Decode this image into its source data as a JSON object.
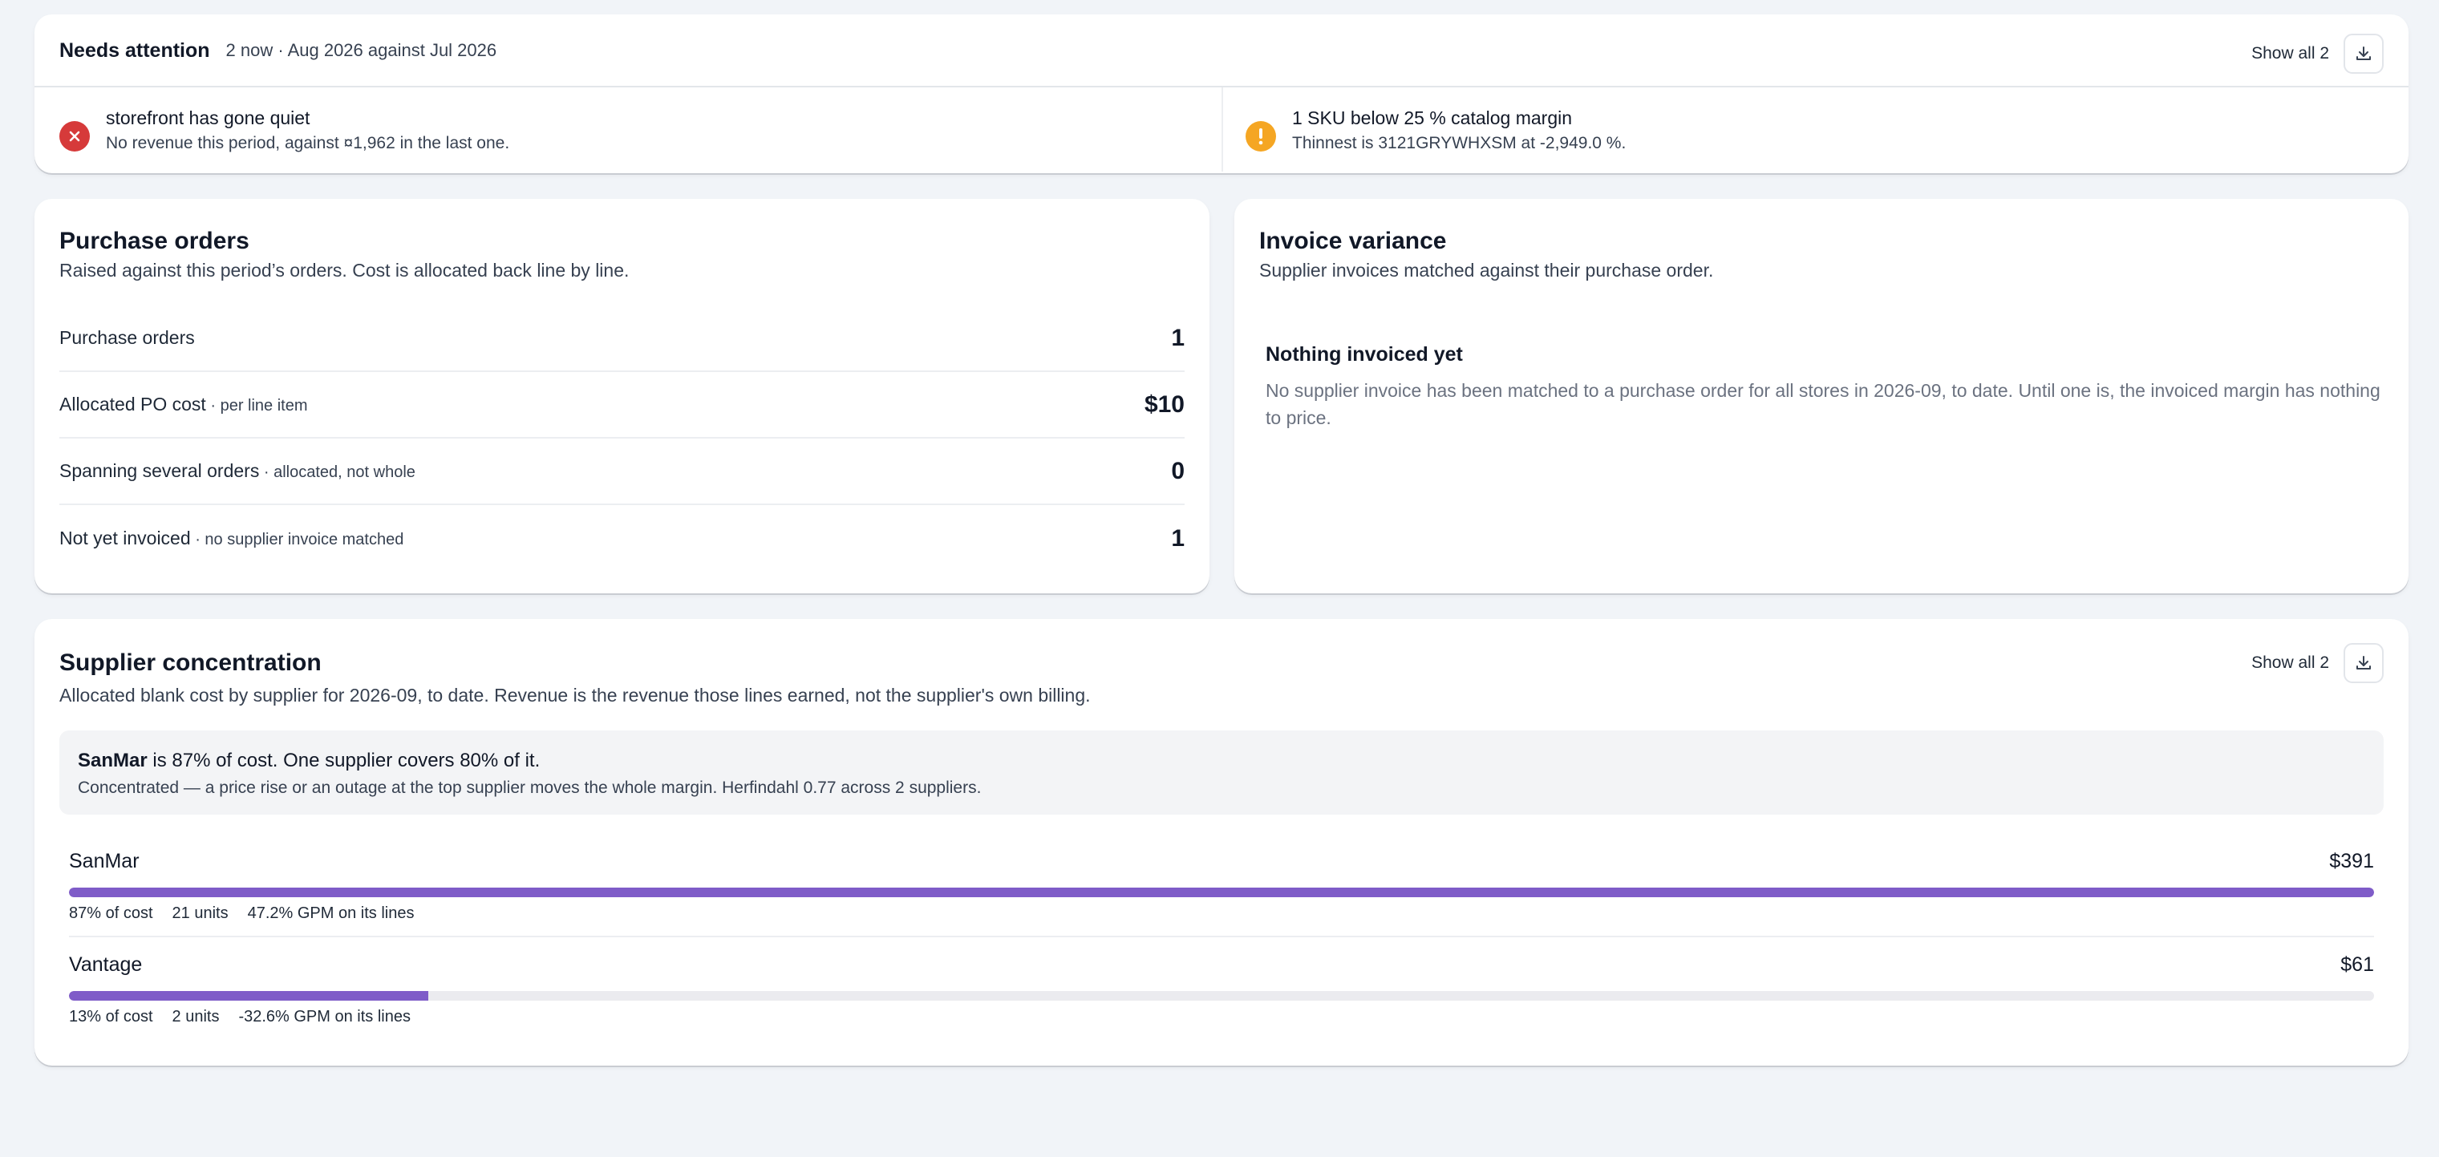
{
  "attention": {
    "title": "Needs attention",
    "subtitle": "2 now · Aug 2026 against Jul 2026",
    "show_all": "Show all 2",
    "alerts": [
      {
        "title": "storefront has gone quiet",
        "desc": "No revenue this period, against ¤1,962 in the last one.",
        "icon": "error-x-icon",
        "color": "#d63a3a"
      },
      {
        "title": "1 SKU below 25 % catalog margin",
        "desc": "Thinnest is 3121GRYWHXSM at -2,949.0 %.",
        "icon": "warning-exclamation-icon",
        "color": "#f5a623"
      }
    ]
  },
  "purchase_orders": {
    "title": "Purchase orders",
    "subtitle": "Raised against this period’s orders. Cost is allocated back line by line.",
    "rows": [
      {
        "label": "Purchase orders",
        "hint": "",
        "value": "1"
      },
      {
        "label": "Allocated PO cost",
        "hint": " · per line item",
        "value": "$10"
      },
      {
        "label": "Spanning several orders",
        "hint": " · allocated, not whole",
        "value": "0"
      },
      {
        "label": "Not yet invoiced",
        "hint": " · no supplier invoice matched",
        "value": "1"
      }
    ]
  },
  "invoice_variance": {
    "title": "Invoice variance",
    "subtitle": "Supplier invoices matched against their purchase order.",
    "empty_title": "Nothing invoiced yet",
    "empty_desc": "No supplier invoice has been matched to a purchase order for all stores in 2026-09, to date. Until one is, the invoiced margin has nothing to price."
  },
  "supplier_concentration": {
    "title": "Supplier concentration",
    "subtitle": "Allocated blank cost by supplier for 2026-09, to date. Revenue is the revenue those lines earned, not the supplier's own billing.",
    "show_all": "Show all 2",
    "callout_bold": "SanMar",
    "callout_rest": " is 87% of cost. One supplier covers 80% of it.",
    "callout_sub": "Concentrated — a price rise or an outage at the top supplier moves the whole margin. Herfindahl 0.77 across 2 suppliers.",
    "suppliers": [
      {
        "name": "SanMar",
        "amount": "$391",
        "share": 1.0,
        "cost_pct": "87% of cost",
        "units": "21 units",
        "gpm": "47.2% GPM on its lines"
      },
      {
        "name": "Vantage",
        "amount": "$61",
        "share": 0.156,
        "cost_pct": "13% of cost",
        "units": "2 units",
        "gpm": "-32.6% GPM on its lines"
      }
    ],
    "bar_color": "#7f5cc8"
  }
}
